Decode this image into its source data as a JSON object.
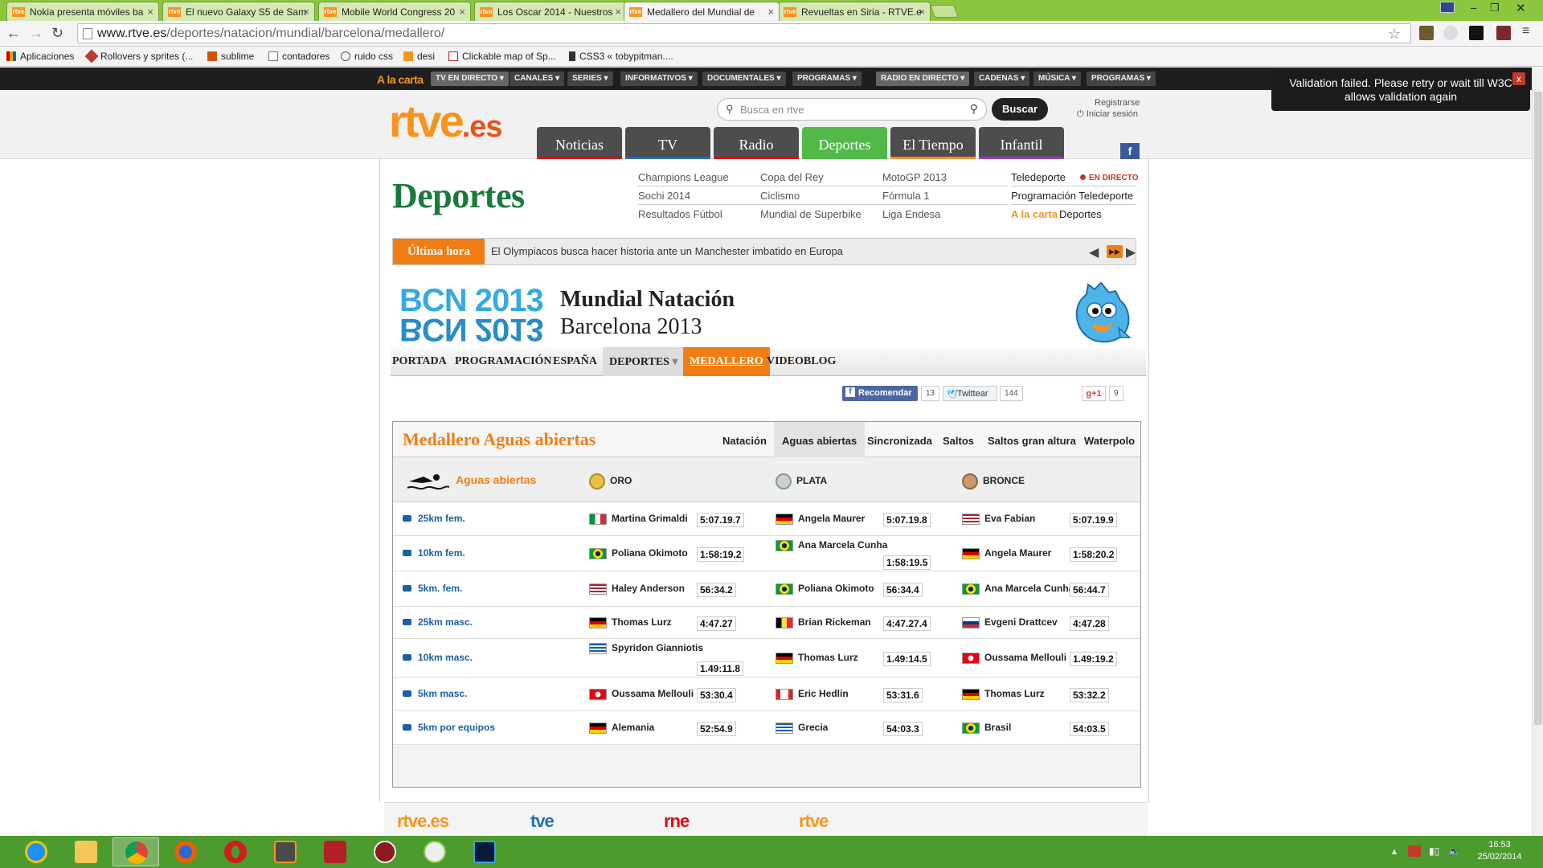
{
  "browser": {
    "tabs": [
      {
        "title": "Nokia presenta móviles ba",
        "favicon": "rtve"
      },
      {
        "title": "El nuevo Galaxy S5 de Sam",
        "favicon": "rtve"
      },
      {
        "title": "Mobile World Congress 20",
        "favicon": "rtve"
      },
      {
        "title": "Los Oscar 2014 - Nuestros",
        "favicon": "rtve"
      },
      {
        "title": "Medallero del Mundial de",
        "favicon": "rtve",
        "active": true
      },
      {
        "title": "Revueltas en Siria - RTVE.e",
        "favicon": "rtve"
      }
    ],
    "url_host": "www.rtve.es",
    "url_path": "/deportes/natacion/mundial/barcelona/medallero/",
    "bookmarks": [
      "Aplicaciones",
      "Rollovers y sprites (...",
      "sublime",
      "contadores",
      "ruido css",
      "desi",
      "Clickable map of Sp...",
      "CSS3 « tobypitman...."
    ],
    "tab_favicon_text": "rtve"
  },
  "validation": {
    "message": "Validation failed. Please retry or wait till W3C allows validation again",
    "close": "x"
  },
  "topbar": {
    "alacarta": "A la carta",
    "tv_items": [
      "TV EN DIRECTO",
      "CANALES",
      "SERIES",
      "INFORMATIVOS",
      "DOCUMENTALES",
      "PROGRAMAS"
    ],
    "radio_items": [
      "RADIO EN DIRECTO",
      "CADENAS",
      "MÚSICA",
      "PROGRAMAS"
    ]
  },
  "header": {
    "logo_main": "rtve",
    "logo_tld": ".es",
    "search_placeholder": "Busca en rtve",
    "search_button": "Buscar",
    "register": "Registrarse",
    "login": "Iniciar sesión",
    "main_tabs": [
      "Noticias",
      "TV",
      "Radio",
      "Deportes",
      "El Tiempo",
      "Infantil"
    ],
    "active_tab": "Deportes",
    "facebook": "f"
  },
  "section": {
    "title": "Deportes",
    "links_col1": [
      "Champions League",
      "Sochi 2014",
      "Resultados Fútbol"
    ],
    "links_col2": [
      "Copa del Rey",
      "Ciclismo",
      "Mundial de Superbike"
    ],
    "links_col3": [
      "MotoGP 2013",
      "Fórmula 1",
      "Liga Endesa"
    ],
    "teledeporte": "Teledeporte",
    "en_directo": "EN DIRECTO",
    "programacion": "Programación Teledeporte",
    "alacarta": "A la carta",
    "alacarta_link": "Deportes"
  },
  "ultima_hora": {
    "label": "Última hora",
    "text": "El Olympiacos busca hacer historia ante un Manchester imbatido en Europa"
  },
  "event": {
    "logo_line1": "BCN 2013",
    "logo_line2": "BCN 2013",
    "title": "Mundial Natación",
    "subtitle": "Barcelona 2013"
  },
  "event_nav": {
    "items": [
      "PORTADA",
      "PROGRAMACIÓN",
      "ESPAÑA",
      "DEPORTES",
      "MEDALLERO",
      "VIDEOBLOG"
    ],
    "active": "MEDALLERO"
  },
  "social": {
    "fb_label": "Recomendar",
    "fb_count": "13",
    "tw_label": "Twittear",
    "tw_count": "144",
    "gplus_label": "g+1",
    "gplus_count": "9"
  },
  "medallero": {
    "title": "Medallero Aguas abiertas",
    "tabs": [
      "Natación",
      "Aguas abiertas",
      "Sincronizada",
      "Saltos",
      "Saltos gran altura",
      "Waterpolo"
    ],
    "active_tab": "Aguas abiertas",
    "discipline": "Aguas abiertas",
    "gold": "ORO",
    "silver": "PLATA",
    "bronze": "BRONCE",
    "rows": [
      {
        "event": "25km fem.",
        "gold": {
          "name": "Martina Grimaldi",
          "flag": "it",
          "time": "5:07.19.7"
        },
        "silver": {
          "name": "Angela Maurer",
          "flag": "de",
          "time": "5:07.19.8"
        },
        "bronze": {
          "name": "Eva Fabian",
          "flag": "us",
          "time": "5:07.19.9"
        }
      },
      {
        "event": "10km fem.",
        "gold": {
          "name": "Poliana Okimoto",
          "flag": "br",
          "time": "1:58:19.2"
        },
        "silver": {
          "name": "Ana Marcela Cunha",
          "flag": "br",
          "time": "1:58:19.5"
        },
        "bronze": {
          "name": "Angela Maurer",
          "flag": "de",
          "time": "1:58:20.2"
        }
      },
      {
        "event": "5km. fem.",
        "gold": {
          "name": "Haley Anderson",
          "flag": "us",
          "time": "56:34.2"
        },
        "silver": {
          "name": "Poliana Okimoto",
          "flag": "br",
          "time": "56:34.4"
        },
        "bronze": {
          "name": "Ana Marcela Cunha",
          "flag": "br",
          "time": "56:44.7"
        }
      },
      {
        "event": "25km masc.",
        "gold": {
          "name": "Thomas Lurz",
          "flag": "de",
          "time": "4:47.27"
        },
        "silver": {
          "name": "Brian Rickeman",
          "flag": "be",
          "time": "4:47.27.4"
        },
        "bronze": {
          "name": "Evgeni Drattcev",
          "flag": "ru",
          "time": "4:47.28"
        }
      },
      {
        "event": "10km masc.",
        "gold": {
          "name": "Spyridon Gianniotis",
          "flag": "gr",
          "time": "1.49:11.8"
        },
        "silver": {
          "name": "Thomas Lurz",
          "flag": "de",
          "time": "1.49:14.5"
        },
        "bronze": {
          "name": "Oussama Mellouli",
          "flag": "tn",
          "time": "1.49:19.2"
        }
      },
      {
        "event": "5km masc.",
        "gold": {
          "name": "Oussama Mellouli",
          "flag": "tn",
          "time": "53:30.4"
        },
        "silver": {
          "name": "Eric Hedlin",
          "flag": "ca",
          "time": "53:31.6"
        },
        "bronze": {
          "name": "Thomas Lurz",
          "flag": "de",
          "time": "53:32.2"
        }
      },
      {
        "event": "5km por equipos",
        "gold": {
          "name": "Alemania",
          "flag": "de",
          "time": "52:54.9"
        },
        "silver": {
          "name": "Grecia",
          "flag": "gr",
          "time": "54:03.3"
        },
        "bronze": {
          "name": "Brasil",
          "flag": "br",
          "time": "54:03.5"
        }
      }
    ]
  },
  "footer": {
    "logos": [
      "rtve.es",
      "tve",
      "rne",
      "rtve"
    ]
  },
  "taskbar": {
    "time": "16:53",
    "date": "25/02/2014",
    "apps": [
      "ie-icon",
      "explorer-icon",
      "chrome-icon",
      "firefox-icon",
      "opera-icon",
      "sublime-icon",
      "filezilla-icon",
      "shutdown-icon",
      "talk-icon",
      "photoshop-icon"
    ]
  },
  "colors": {
    "rtve_orange": "#f7941d",
    "deportes_green": "#52b949",
    "medallero_orange": "#f07e14",
    "taskbar_green": "#4d9a2e"
  }
}
